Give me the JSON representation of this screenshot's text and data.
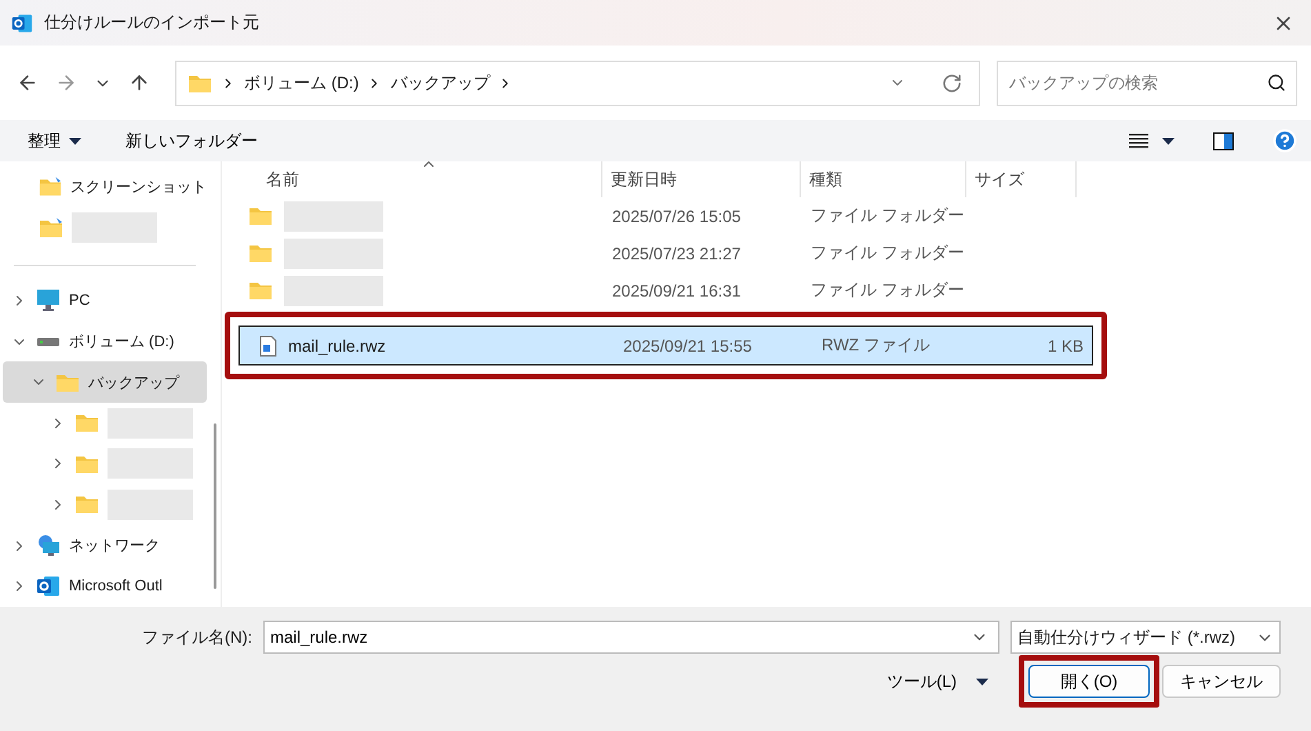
{
  "window": {
    "title": "仕分けルールのインポート元"
  },
  "address": {
    "crumbs": [
      "ボリューム (D:)",
      "バックアップ"
    ]
  },
  "search": {
    "placeholder": "バックアップの検索"
  },
  "commands": {
    "organize": "整理",
    "new_folder": "新しいフォルダー"
  },
  "sidebar": {
    "groups": [
      {
        "items": [
          {
            "kind": "pinned",
            "label": "スクリーンショット"
          },
          {
            "kind": "pinned"
          }
        ]
      },
      {
        "items": [
          {
            "kind": "pc",
            "label": "PC",
            "expanded": false,
            "selected": false
          },
          {
            "kind": "drive",
            "label": "ボリューム (D:)",
            "expanded": true,
            "selected": false,
            "children": [
              {
                "kind": "folder",
                "label": "バックアップ",
                "expanded": true,
                "selected": true,
                "children": [
                  {
                    "kind": "folder",
                    "expanded": false,
                    "selected": false
                  },
                  {
                    "kind": "folder",
                    "expanded": false,
                    "selected": false
                  },
                  {
                    "kind": "folder",
                    "expanded": false,
                    "selected": false
                  }
                ]
              }
            ]
          },
          {
            "kind": "network",
            "label": "ネットワーク",
            "expanded": false,
            "selected": false
          },
          {
            "kind": "outlook",
            "label": "Microsoft Outl",
            "expanded": false,
            "selected": false
          }
        ]
      }
    ]
  },
  "table": {
    "columns": [
      {
        "label": "名前",
        "sorted": true
      },
      {
        "label": "更新日時",
        "sorted": false
      },
      {
        "label": "種類",
        "sorted": false
      },
      {
        "label": "サイズ",
        "sorted": false
      }
    ],
    "rows": [
      {
        "kind": "folder",
        "modified": "2025/07/26 15:05",
        "type": "ファイル フォルダー",
        "selected": false,
        "annotated": false
      },
      {
        "kind": "folder",
        "modified": "2025/07/23 21:27",
        "type": "ファイル フォルダー",
        "selected": false,
        "annotated": false
      },
      {
        "kind": "folder",
        "modified": "2025/09/21 16:31",
        "type": "ファイル フォルダー",
        "selected": false,
        "annotated": false
      },
      {
        "kind": "file",
        "name": "mail_rule.rwz",
        "modified": "2025/09/21 15:55",
        "type": "RWZ ファイル",
        "size": "1 KB",
        "selected": true,
        "annotated": true
      }
    ]
  },
  "footer": {
    "filename_label": "ファイル名(N):",
    "filename": "mail_rule.rwz",
    "filter": "自動仕分けウィザード (*.rwz)",
    "tools": "ツール(L)",
    "open": {
      "label": "開く(O)",
      "annotated": true
    },
    "cancel": "キャンセル"
  }
}
